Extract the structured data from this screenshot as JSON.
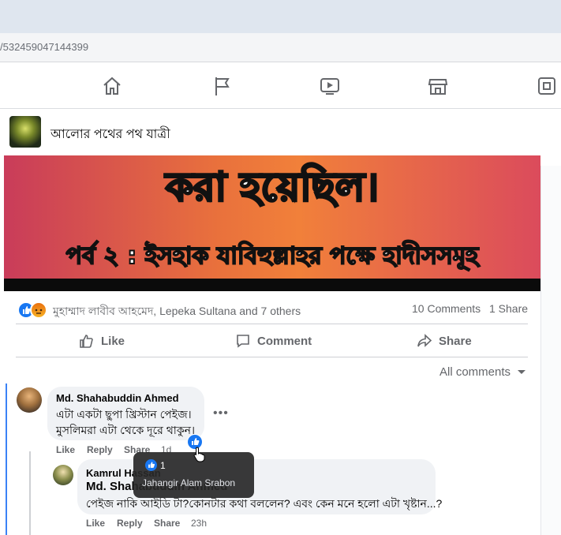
{
  "browser": {
    "address_fragment": "/532459047144399"
  },
  "nav": {
    "icons": [
      "home-icon",
      "flag-icon",
      "video-icon",
      "marketplace-icon",
      "gaming-icon"
    ]
  },
  "post": {
    "page_name": "আলোর পথের পথ যাত্রী",
    "banner_line1": "করা হয়েছিল।",
    "banner_line2": "পর্ব ২ : ইসহাক যাবিহুল্লাহর পক্ষে হাদীসসমূহ",
    "reaction_names": "মুহাম্মাদ লাবীব আহমেদ, Lepeka Sultana and 7 others",
    "comments_count": "10 Comments",
    "shares_count": "1 Share",
    "actions": {
      "like": "Like",
      "comment": "Comment",
      "share": "Share"
    },
    "filter_label": "All comments"
  },
  "comments": [
    {
      "author": "Md. Shahabuddin Ahmed",
      "line1": "এটা একটা ছুপা খ্রিস্টান পেইজ।",
      "line2": "মুসলিমরা এটা থেকে দূরে থাকুন।",
      "like": "Like",
      "reply": "Reply",
      "share": "Share",
      "time": "1d",
      "tooltip": {
        "count": "1",
        "reactor": "Jahangir Alam Srabon"
      }
    },
    {
      "author": "Kamrul Hassan",
      "tag": "Md. Shahabuddin Ahmed",
      "text": "পেইজ নাকি আইডি টা?কোনটার কথা বললেন? এবং কেন মনে হলো এটা খৃষ্টান...?",
      "like": "Like",
      "reply": "Reply",
      "share": "Share",
      "time": "23h"
    }
  ],
  "colors": {
    "accent": "#1877f2",
    "muted": "#65676b",
    "bubble": "#f0f2f5"
  }
}
